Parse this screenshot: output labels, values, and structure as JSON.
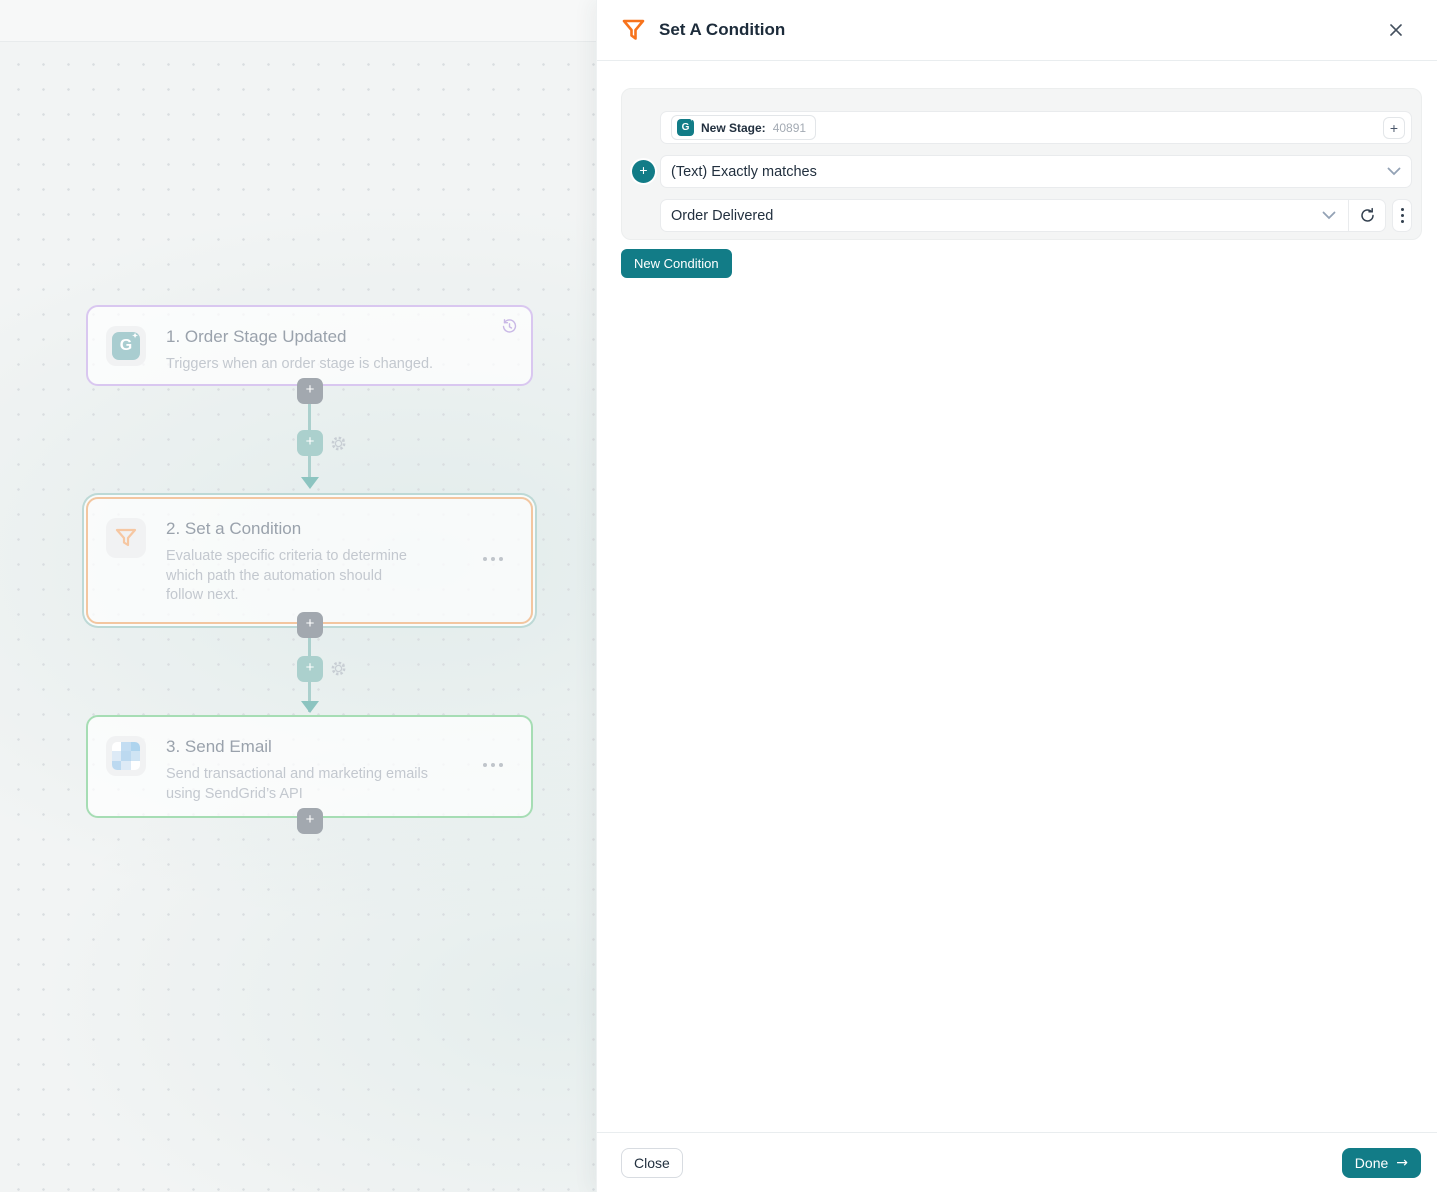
{
  "panel": {
    "title": "Set A Condition",
    "condition_card": {
      "field_chip": {
        "label": "New Stage:",
        "value": "40891"
      },
      "operator_select": "(Text) Exactly matches",
      "value_select": "Order Delivered",
      "new_condition_button": "New Condition"
    },
    "footer": {
      "close_button": "Close",
      "done_button": "Done",
      "done_arrow": "→"
    },
    "icons": {
      "header": "funnel-icon",
      "close": "close-icon"
    }
  },
  "canvas": {
    "nodes": [
      {
        "title": "1. Order Stage Updated",
        "description": "Triggers when an order stage is changed.",
        "icon": "g-app-icon"
      },
      {
        "title": "2. Set a Condition",
        "description": "Evaluate specific criteria to determine which path the automation should follow next.",
        "icon": "funnel-icon"
      },
      {
        "title": "3. Send Email",
        "description": "Send transactional and marketing emails using SendGrid’s API",
        "icon": "sendgrid-icon"
      }
    ],
    "connector_plus": "+",
    "app_icon_letter": "G",
    "app_icon_spark": "✦"
  },
  "colors": {
    "accent_teal": "#127c87",
    "accent_orange": "#f7731c",
    "node1_border": "#d9c7f0",
    "node2_border": "#f3c6a0",
    "node3_border": "#a6ddb4",
    "connector": "#abd0cd",
    "canvas_bg": "#f2f4f4",
    "card_bg": "#f4f5f5"
  }
}
